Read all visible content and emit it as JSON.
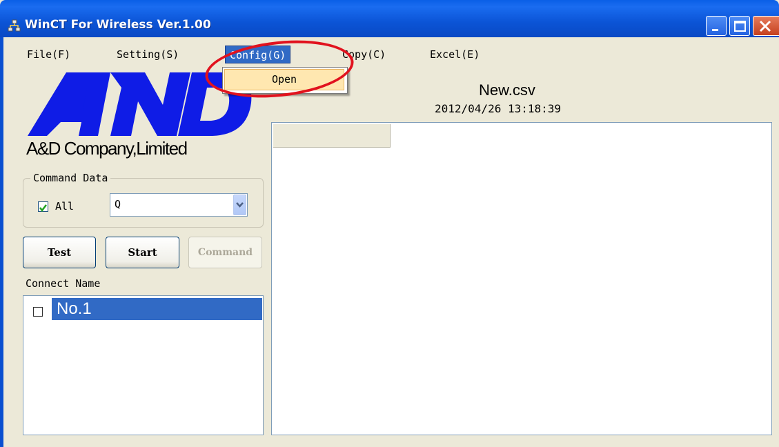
{
  "window": {
    "title": "WinCT For Wireless Ver.1.00"
  },
  "menu": {
    "items": [
      {
        "label": "File(F)"
      },
      {
        "label": "Setting(S)"
      },
      {
        "label": "Config(G)",
        "active": true
      },
      {
        "label": "Copy(C)"
      },
      {
        "label": "Excel(E)"
      }
    ],
    "dropdown": {
      "items": [
        {
          "label": "Open",
          "highlighted": true
        }
      ]
    }
  },
  "annotation": {
    "color": "#e1121e"
  },
  "branding": {
    "logo_text": "A&D",
    "company_name": "A&D Company,Limited",
    "logo_color": "#0f1ce6"
  },
  "command_data": {
    "legend": "Command Data",
    "all_checked": true,
    "all_label": "All",
    "selected_value": "Q"
  },
  "buttons": {
    "test": "Test",
    "start": "Start",
    "command": "Command"
  },
  "connect": {
    "label": "Connect Name",
    "items": [
      {
        "label": "No.1",
        "checked": false,
        "selected": true
      }
    ]
  },
  "file": {
    "name": "New.csv",
    "datetime": "2012/04/26 13:18:39"
  },
  "colors": {
    "titlebar": "#0b54d6",
    "selection": "#316ac5",
    "window_bg": "#ece9d8"
  }
}
